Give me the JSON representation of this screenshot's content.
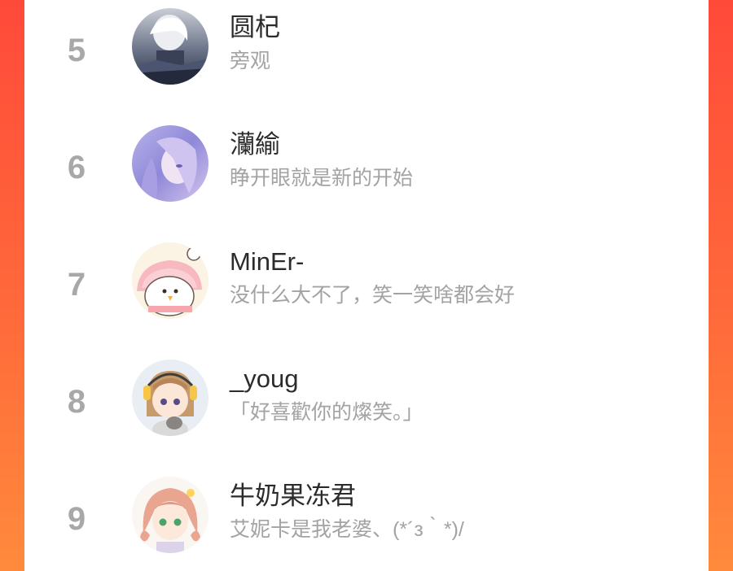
{
  "ranking": {
    "items": [
      {
        "rank": "5",
        "name": "圆杞",
        "desc": "旁观"
      },
      {
        "rank": "6",
        "name": "灡緰",
        "desc": "睁开眼就是新的开始"
      },
      {
        "rank": "7",
        "name": "MinEr-",
        "desc": "没什么大不了，笑一笑啥都会好"
      },
      {
        "rank": "8",
        "name": "_youg",
        "desc": "「好喜歡你的燦笑。」"
      },
      {
        "rank": "9",
        "name": "牛奶果冻君",
        "desc": "艾妮卡是我老婆、(*´з｀*)/"
      }
    ]
  },
  "colors": {
    "background_gradient_top": "#ff4a3a",
    "background_gradient_bottom": "#ff8a3c",
    "card": "#ffffff",
    "rank": "#a8a8a8",
    "name": "#2b2b2b",
    "desc": "#a3a3a3"
  }
}
